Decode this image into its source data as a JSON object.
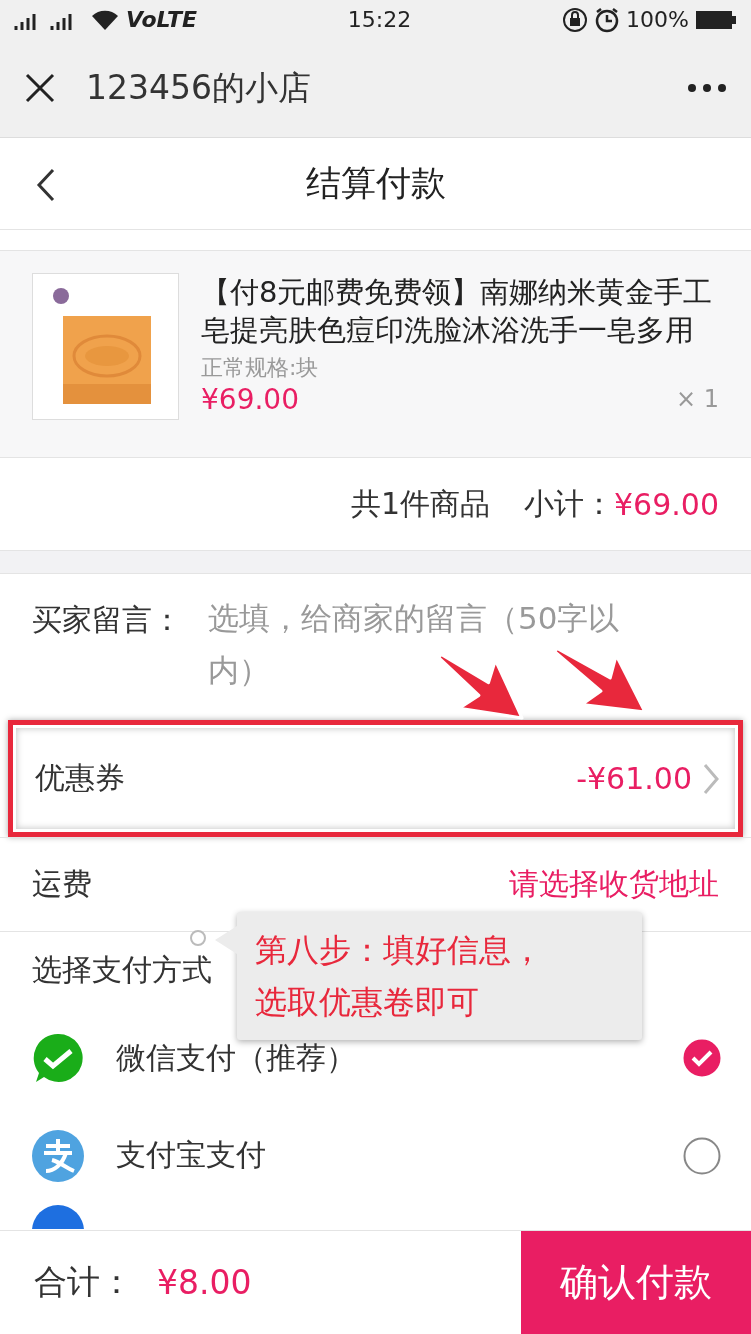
{
  "status_bar": {
    "network": "VoLTE",
    "time": "15:22",
    "battery": "100%"
  },
  "nav_bar": {
    "title": "123456的小店"
  },
  "header": {
    "title": "结算付款"
  },
  "product": {
    "title": "【付8元邮费免费领】南娜纳米黄金手工皂提亮肤色痘印洗脸沐浴洗手一皂多用",
    "spec": "正常规格:块",
    "price": "¥69.00",
    "quantity": "× 1"
  },
  "summary": {
    "count": "共1件商品",
    "subtotal_label": "小计：",
    "subtotal": "¥69.00"
  },
  "message": {
    "label": "买家留言：",
    "placeholder": "选填，给商家的留言（50字以内）"
  },
  "coupon": {
    "label": "优惠券",
    "value": "-¥61.00",
    "highlighted": true
  },
  "shipping": {
    "label": "运费",
    "value": "请选择收货地址"
  },
  "payment": {
    "heading": "选择支付方式",
    "methods": [
      {
        "kind": "wechat",
        "name": "微信支付（推荐）",
        "selected": true
      },
      {
        "kind": "alipay",
        "name": "支付宝支付",
        "selected": false
      },
      {
        "kind": "partial"
      }
    ]
  },
  "annotation": {
    "lines": [
      "第八步：填好信息，",
      "选取优惠卷即可"
    ]
  },
  "footer": {
    "total_label": "合计：",
    "total": "¥8.00",
    "button": "确认付款"
  }
}
